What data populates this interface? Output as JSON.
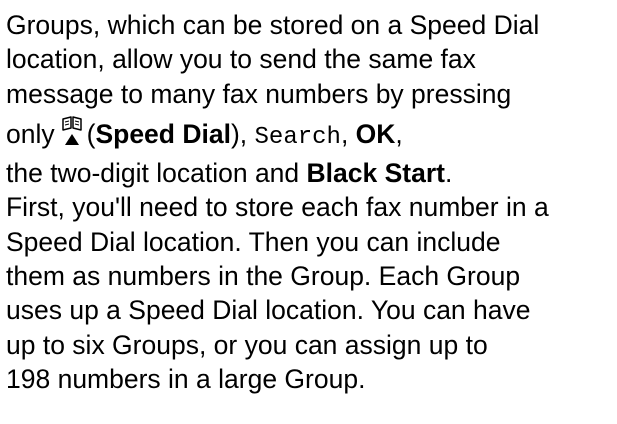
{
  "paragraph": {
    "line1": "Groups, which can be stored on a Speed Dial",
    "line2": "location, allow you to send the same fax",
    "line3": "message to many fax numbers by pressing",
    "line4_pre": "only",
    "speed_dial_icon": "speed-dial-book-icon",
    "line4_open_paren": "(",
    "line4_bold1": "Speed Dial",
    "line4_close_paren": "), ",
    "line4_mono": "Search",
    "line4_comma": ", ",
    "line4_bold2": "OK",
    "line4_end": ",",
    "line5_pre": "the two-digit location and ",
    "line5_bold": "Black Start",
    "line5_end": ".",
    "line6": "First, you'll need to store each fax number in a",
    "line7": "Speed Dial location. Then you can include",
    "line8": "them as numbers in the Group. Each Group",
    "line9": "uses up a Speed Dial location. You can have",
    "line10": "up to six Groups, or you can assign up to",
    "line11": "198 numbers in a large Group."
  }
}
